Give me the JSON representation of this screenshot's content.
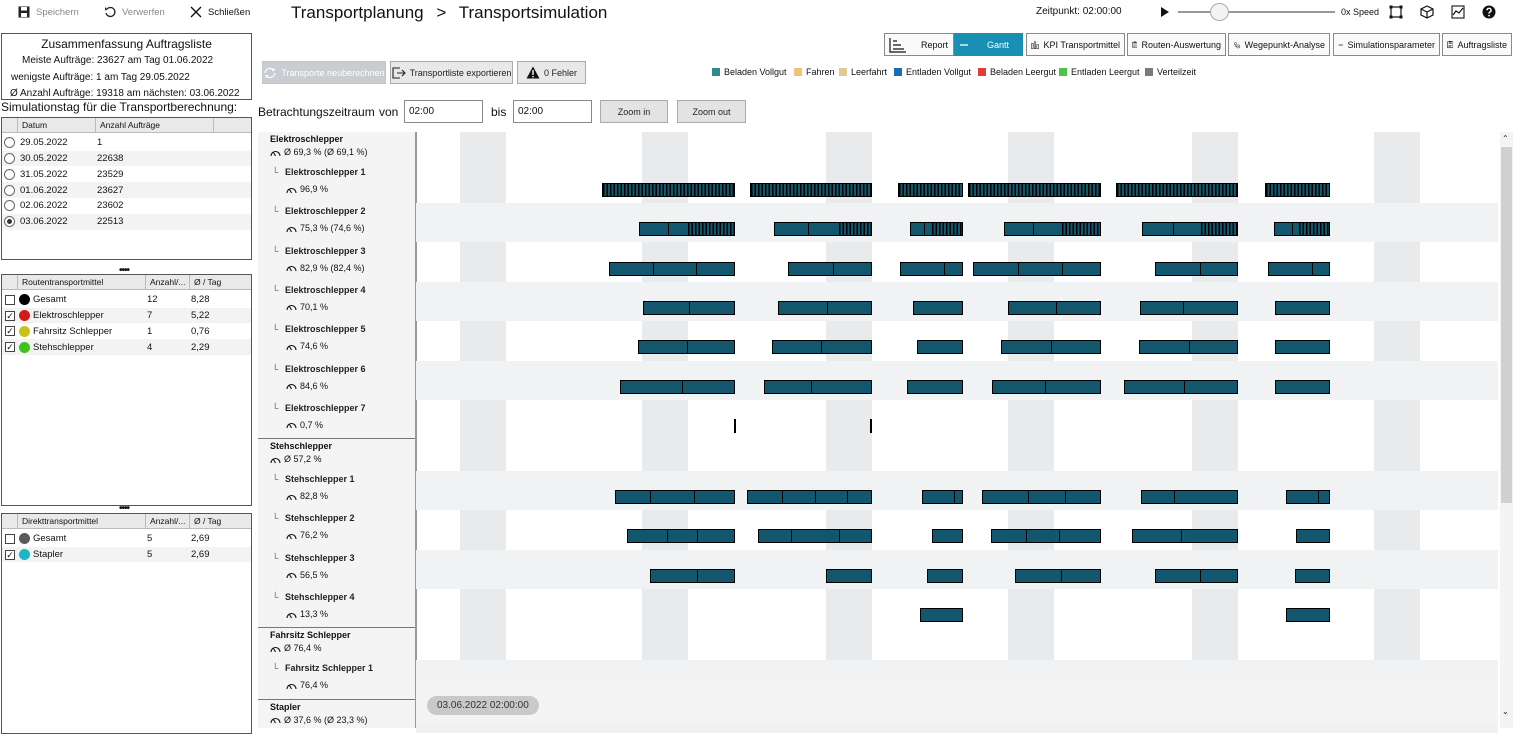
{
  "toolbar": {
    "save": "Speichern",
    "discard": "Verwerfen",
    "close": "Schließen"
  },
  "title": {
    "part1": "Transportplanung",
    "separator": ">",
    "part2": "Transportsimulation"
  },
  "time_controls": {
    "time_label": "Zeitpunkt: 02:00:00",
    "speed_label": "0x Speed",
    "slider_fraction": 0.26
  },
  "summary": {
    "heading": "Zusammenfassung Auftragsliste",
    "line1": "Meiste Aufträge: 23627 am Tag 01.06.2022",
    "line2": "wenigste Aufträge: 1 am Tag 29.05.2022",
    "line3": "Ø Anzahl Aufträge: 19318 am nächsten: 03.06.2022"
  },
  "sim_day": {
    "label": "Simulationstag für die Transportberechnung:",
    "col_date": "Datum",
    "col_count": "Anzahl Aufträge",
    "rows": [
      {
        "date": "29.05.2022",
        "count": "1",
        "selected": false
      },
      {
        "date": "30.05.2022",
        "count": "22638",
        "selected": false
      },
      {
        "date": "31.05.2022",
        "count": "23529",
        "selected": false
      },
      {
        "date": "01.06.2022",
        "count": "23627",
        "selected": false
      },
      {
        "date": "02.06.2022",
        "count": "23602",
        "selected": false
      },
      {
        "date": "03.06.2022",
        "count": "22513",
        "selected": true
      }
    ]
  },
  "route_transport": {
    "col_name": "Routentransportmittel",
    "col_count": "Anzahl/...",
    "col_avg": "Ø / Tag",
    "rows": [
      {
        "name": "Gesamt",
        "count": "12",
        "avg": "8,28",
        "checked": false,
        "color": "#000000"
      },
      {
        "name": "Elektroschlepper",
        "count": "7",
        "avg": "5,22",
        "checked": true,
        "color": "#d21a1a"
      },
      {
        "name": "Fahrsitz Schlepper",
        "count": "1",
        "avg": "0,76",
        "checked": true,
        "color": "#c9c21a"
      },
      {
        "name": "Stehschlepper",
        "count": "4",
        "avg": "2,29",
        "checked": true,
        "color": "#3ec31e"
      }
    ]
  },
  "direct_transport": {
    "col_name": "Direkttransportmittel",
    "col_count": "Anzahl/...",
    "col_avg": "Ø / Tag",
    "rows": [
      {
        "name": "Gesamt",
        "count": "5",
        "avg": "2,69",
        "checked": false,
        "color": "#5a5a5a"
      },
      {
        "name": "Stapler",
        "count": "5",
        "avg": "2,69",
        "checked": true,
        "color": "#1ab8c4"
      }
    ]
  },
  "actions": {
    "recalc": "Transporte neuberechnen",
    "export": "Transportliste exportieren",
    "errors": "0 Fehler"
  },
  "tabs": [
    {
      "label": "Report",
      "active": false
    },
    {
      "label": "Gantt",
      "active": true
    },
    {
      "label": "KPI Transportmittel",
      "active": false
    },
    {
      "label": "Routen-Auswertung",
      "active": false
    },
    {
      "label": "Wegepunkt-Analyse",
      "active": false
    },
    {
      "label": "Simulationsparameter",
      "active": false
    },
    {
      "label": "Auftragsliste",
      "active": false
    }
  ],
  "legend": [
    {
      "label": "Beladen Vollgut",
      "color": "#2f8a8f"
    },
    {
      "label": "Fahren",
      "color": "#f2c27a"
    },
    {
      "label": "Leerfahrt",
      "color": "#e3c892"
    },
    {
      "label": "Entladen Vollgut",
      "color": "#1a6fb0"
    },
    {
      "label": "Beladen Leergut",
      "color": "#e33a3a"
    },
    {
      "label": "Entladen Leergut",
      "color": "#4ec24a"
    },
    {
      "label": "Verteilzeit",
      "color": "#7a7a7a"
    }
  ],
  "period": {
    "label": "Betrachtungszeitraum",
    "from_label": "von",
    "from_value": "02:00",
    "to_label": "bis",
    "to_value": "02:00",
    "zoom_in": "Zoom in",
    "zoom_out": "Zoom out"
  },
  "gantt": {
    "groups": [
      {
        "name": "Elektroschlepper",
        "util": "Ø 69,3 % (Ø 69,1 %)",
        "items": [
          {
            "name": "Elektroschlepper 1",
            "util": "96,9 %"
          },
          {
            "name": "Elektroschlepper 2",
            "util": "75,3 % (74,6 %)"
          },
          {
            "name": "Elektroschlepper 3",
            "util": "82,9 % (82,4 %)"
          },
          {
            "name": "Elektroschlepper 4",
            "util": "70,1 %"
          },
          {
            "name": "Elektroschlepper 5",
            "util": "74,6 %"
          },
          {
            "name": "Elektroschlepper 6",
            "util": "84,6 %"
          },
          {
            "name": "Elektroschlepper 7",
            "util": "0,7 %"
          }
        ]
      },
      {
        "name": "Stehschlepper",
        "util": "Ø 57,2 %",
        "items": [
          {
            "name": "Stehschlepper 1",
            "util": "82,8 %"
          },
          {
            "name": "Stehschlepper 2",
            "util": "76,2 %"
          },
          {
            "name": "Stehschlepper 3",
            "util": "56,5 %"
          },
          {
            "name": "Stehschlepper 4",
            "util": "13,3 %"
          }
        ]
      },
      {
        "name": "Fahrsitz Schlepper",
        "util": "Ø 76,4 %",
        "items": [
          {
            "name": "Fahrsitz Schlepper 1",
            "util": "76,4 %"
          }
        ]
      },
      {
        "name": "Stapler",
        "util": "Ø 37,6 % (Ø 23,3 %)",
        "items": []
      }
    ],
    "timestamp": "03.06.2022 02:00:00"
  },
  "colors": {
    "accent": "#1a8fb4",
    "bar": "#12576e"
  }
}
